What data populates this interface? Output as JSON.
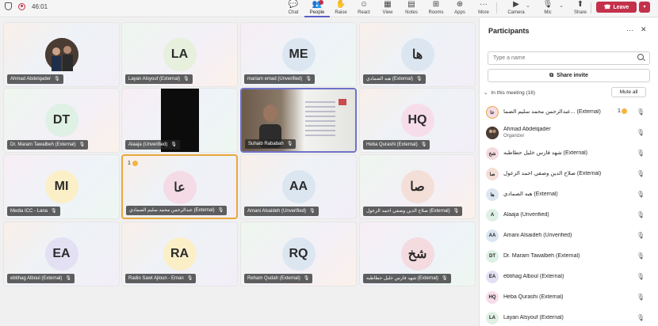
{
  "topbar": {
    "timer": "46:01",
    "tools": [
      {
        "label": "Chat",
        "icon": "chat-icon",
        "glyph": "💬"
      },
      {
        "label": "People",
        "icon": "people-icon",
        "glyph": "👥"
      },
      {
        "label": "Raise",
        "icon": "raise-hand-icon",
        "glyph": "✋"
      },
      {
        "label": "React",
        "icon": "react-icon",
        "glyph": "☺"
      },
      {
        "label": "View",
        "icon": "view-icon",
        "glyph": "▦"
      },
      {
        "label": "Notes",
        "icon": "notes-icon",
        "glyph": "▤"
      },
      {
        "label": "Rooms",
        "icon": "rooms-icon",
        "glyph": "⊞"
      },
      {
        "label": "Apps",
        "icon": "apps-icon",
        "glyph": "⊕"
      },
      {
        "label": "More",
        "icon": "more-icon",
        "glyph": "···"
      },
      {
        "label": "Camera",
        "icon": "camera-icon",
        "glyph": "▶"
      },
      {
        "label": "Mic",
        "icon": "mic-icon",
        "glyph": "🎙"
      },
      {
        "label": "Share",
        "icon": "share-icon",
        "glyph": "⬆"
      }
    ],
    "leave_label": "Leave"
  },
  "tiles": [
    {
      "name": "Ahmad Abdelqader",
      "initials": "",
      "avatar_color": "#ffffff",
      "kind": "photo"
    },
    {
      "name": "Layan Alsyouf (External)",
      "initials": "LA",
      "avatar_color": "#e6f0dc"
    },
    {
      "name": "mariam emad (Unverified)",
      "initials": "ME",
      "avatar_color": "#dbe6f1"
    },
    {
      "name": "هبه الصمادي (External)",
      "initials": "ها",
      "avatar_color": "#dbe6f1"
    },
    {
      "name": "Dr. Maram Tawalbeh (External)",
      "initials": "DT",
      "avatar_color": "#dff0e4"
    },
    {
      "name": "Alaaja (Unverified)",
      "initials": "",
      "avatar_color": "#000000",
      "kind": "dark"
    },
    {
      "name": "Suhaib Rababah",
      "initials": "",
      "avatar_color": "#ffffff",
      "kind": "video"
    },
    {
      "name": "Heba Qurashi (External)",
      "initials": "HQ",
      "avatar_color": "#f7dde9"
    },
    {
      "name": "Media ICC - Lana",
      "initials": "MI",
      "avatar_color": "#fbefc8"
    },
    {
      "name": "عبدالرحمن محمد سليم الصمادي (External)",
      "initials": "عا",
      "avatar_color": "#f4dbe6",
      "hand": "1"
    },
    {
      "name": "Amani Alsaideh (Unverified)",
      "initials": "AA",
      "avatar_color": "#dbe6f1"
    },
    {
      "name": "صلاح الدين وصفي احمد الزعول (External)",
      "initials": "صا",
      "avatar_color": "#f4dfd8"
    },
    {
      "name": "ebtihag Alboul (External)",
      "initials": "EA",
      "avatar_color": "#e3e0f4"
    },
    {
      "name": "Radio Sawt Ajloun - Eman",
      "initials": "RA",
      "avatar_color": "#fbefc8"
    },
    {
      "name": "Reham Qudah (External)",
      "initials": "RQ",
      "avatar_color": "#dbe6f1"
    },
    {
      "name": "شهد فارس خليل حطاطبه (External)",
      "initials": "شخ",
      "avatar_color": "#f4dbe0"
    }
  ],
  "panel": {
    "title": "Participants",
    "search_placeholder": "Type a name",
    "share_invite": "Share invite",
    "in_meeting": "In this meeting (16)",
    "mute_all": "Mute all",
    "participants": [
      {
        "name": "عبدالرحمن محمد سليم الصما... (External)",
        "initials": "عا",
        "color": "#f4dbe6",
        "hand": "1",
        "ring": true
      },
      {
        "name": "Ahmad Abdelqader",
        "sub": "Organizer",
        "initials": "",
        "color": "#5b4a3e",
        "photo": true
      },
      {
        "name": "شهد فارس خليل حطاطبه (External)",
        "initials": "شخ",
        "color": "#f4dbe0"
      },
      {
        "name": "صلاح الدين وصفي احمد الزعول (External)",
        "initials": "صا",
        "color": "#f4dfd8"
      },
      {
        "name": "هبه الصمادي (External)",
        "initials": "ها",
        "color": "#dbe6f1"
      },
      {
        "name": "Alaaja (Unverified)",
        "initials": "A",
        "color": "#dff0e4"
      },
      {
        "name": "Amani Alsaideh (Unverified)",
        "initials": "AA",
        "color": "#dbe6f1"
      },
      {
        "name": "Dr. Maram Tawalbeh (External)",
        "initials": "DT",
        "color": "#dff0e4"
      },
      {
        "name": "ebtihag Alboul (External)",
        "initials": "EA",
        "color": "#e3e0f4"
      },
      {
        "name": "Heba Qurashi (External)",
        "initials": "HQ",
        "color": "#f7dde9"
      },
      {
        "name": "Layan Alsyouf (External)",
        "initials": "LA",
        "color": "#dff0e4"
      }
    ]
  }
}
